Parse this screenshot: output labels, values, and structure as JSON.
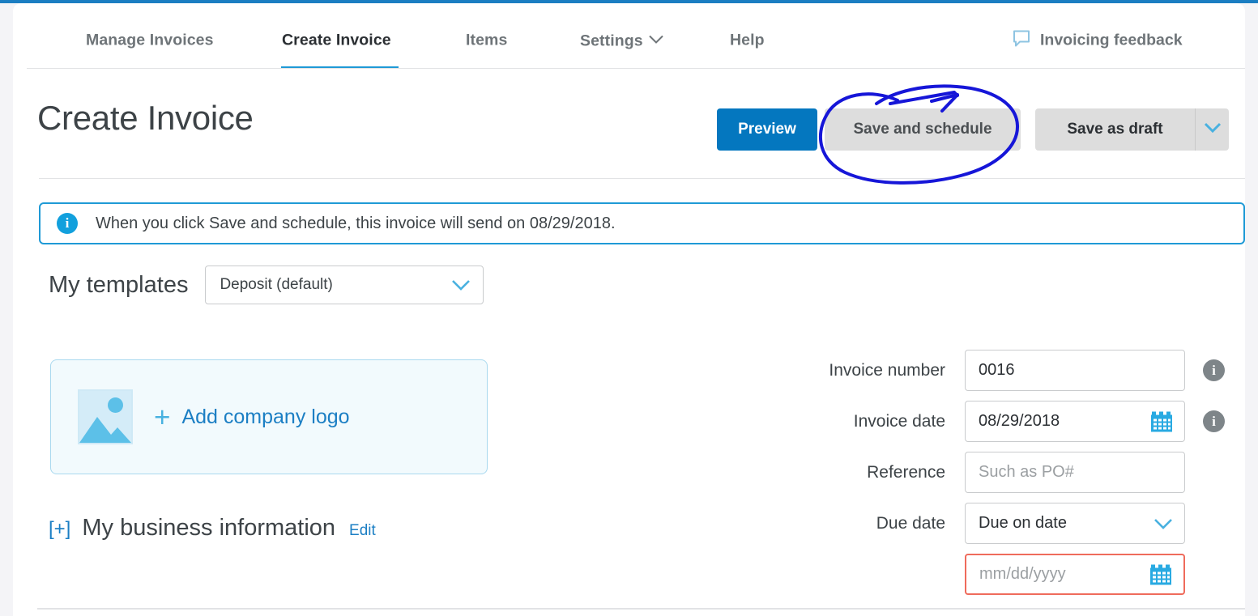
{
  "nav": {
    "items": [
      {
        "label": "Manage Invoices",
        "active": false
      },
      {
        "label": "Create Invoice",
        "active": true
      },
      {
        "label": "Items",
        "active": false
      },
      {
        "label": "Settings",
        "active": false,
        "caret": true
      },
      {
        "label": "Help",
        "active": false
      }
    ],
    "feedback_label": "Invoicing feedback",
    "feedback_icon": "speech-bubble-icon"
  },
  "header": {
    "title": "Create Invoice",
    "buttons": {
      "preview": "Preview",
      "save_and_schedule": "Save and schedule",
      "save_as_draft": "Save as draft",
      "draft_caret_icon": "chevron-down-icon"
    }
  },
  "banner": {
    "icon": "info-icon",
    "text": "When you click Save and schedule, this invoice will send on 08/29/2018.",
    "accent_color": "#1f9ad6"
  },
  "templates": {
    "label": "My templates",
    "selected": "Deposit (default)",
    "caret_icon": "chevron-down-icon"
  },
  "logo": {
    "placeholder_icon": "image-placeholder-icon",
    "plus_icon": "plus-icon",
    "add_label": "Add company logo"
  },
  "business": {
    "expander": "[+]",
    "title": "My business information",
    "edit": "Edit"
  },
  "form": {
    "invoice_number": {
      "label": "Invoice number",
      "value": "0016",
      "info_icon": "info-icon"
    },
    "invoice_date": {
      "label": "Invoice date",
      "value": "08/29/2018",
      "calendar_icon": "calendar-icon",
      "info_icon": "info-icon"
    },
    "reference": {
      "label": "Reference",
      "value": "",
      "placeholder": "Such as PO#"
    },
    "due_date": {
      "label": "Due date",
      "selected": "Due on date",
      "caret_icon": "chevron-down-icon"
    },
    "due_date_input": {
      "value": "",
      "placeholder": "mm/dd/yyyy",
      "calendar_icon": "calendar-icon",
      "state": "error",
      "error_color": "#ef6b5c"
    }
  },
  "annotation": {
    "shape": "hand-drawn-ellipse-with-arrow",
    "color": "#1616d8",
    "target": "Save and schedule"
  }
}
